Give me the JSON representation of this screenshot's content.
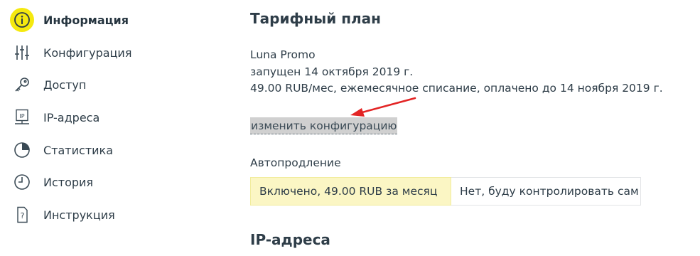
{
  "sidebar": {
    "items": [
      {
        "label": "Информация",
        "icon": "info-icon",
        "active": true
      },
      {
        "label": "Конфигурация",
        "icon": "sliders-icon",
        "active": false
      },
      {
        "label": "Доступ",
        "icon": "key-icon",
        "active": false
      },
      {
        "label": "IP-адреса",
        "icon": "ip-icon",
        "active": false
      },
      {
        "label": "Статистика",
        "icon": "pie-chart-icon",
        "active": false
      },
      {
        "label": "История",
        "icon": "clock-icon",
        "active": false
      },
      {
        "label": "Инструкция",
        "icon": "help-document-icon",
        "active": false
      }
    ]
  },
  "main": {
    "plan_title": "Тарифный план",
    "plan_name": "Luna Promo",
    "plan_started": "запущен 14 октября 2019 г.",
    "plan_price": "49.00 RUB/мес, ежемесячное списание, оплачено до 14 ноября 2019 г.",
    "change_link": "изменить конфигурацию",
    "autorenew_label": "Автопродление",
    "autorenew_options": [
      {
        "label": "Включено, 49.00 RUB за месяц",
        "selected": true
      },
      {
        "label": "Нет, буду контролировать сам",
        "selected": false
      }
    ],
    "ip_title": "IP-адреса"
  },
  "colors": {
    "accent_yellow": "#f5e90f",
    "selected_option_bg": "#fbf6c4",
    "annotation_arrow": "#e32424",
    "text": "#2e3d48"
  }
}
